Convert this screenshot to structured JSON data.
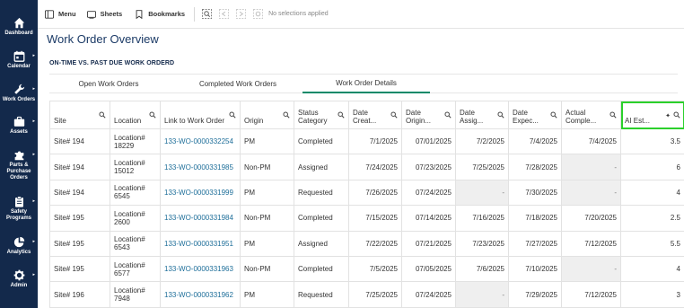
{
  "sidebar": {
    "items": [
      {
        "label": "Dashboard",
        "icon": "home-icon",
        "has_arrow": false
      },
      {
        "label": "Calendar",
        "icon": "calendar-icon",
        "has_arrow": true
      },
      {
        "label": "Work Orders",
        "icon": "wrench-icon",
        "has_arrow": true
      },
      {
        "label": "Assets",
        "icon": "briefcase-icon",
        "has_arrow": true
      },
      {
        "label": "Parts &\nPurchase\nOrders",
        "icon": "puzzle-icon",
        "has_arrow": true
      },
      {
        "label": "Safety\nPrograms",
        "icon": "clipboard-icon",
        "has_arrow": true
      },
      {
        "label": "Analytics",
        "icon": "pie-chart-icon",
        "has_arrow": true
      },
      {
        "label": "Admin",
        "icon": "gear-icon",
        "has_arrow": true
      }
    ]
  },
  "toolbar": {
    "menu_label": "Menu",
    "sheets_label": "Sheets",
    "bookmarks_label": "Bookmarks",
    "selection_status": "No selections applied"
  },
  "page_title": "Work Order Overview",
  "section_title": "ON-TIME VS. PAST DUE WORK ORDERD",
  "tabs": [
    {
      "label": "Open Work Orders",
      "active": false
    },
    {
      "label": "Completed Work Orders",
      "active": false
    },
    {
      "label": "Work Order Details",
      "active": true
    }
  ],
  "table": {
    "columns": [
      "Site",
      "Location",
      "Link to Work Order",
      "Origin",
      "Status Category",
      "Date Creat...",
      "Date Origin...",
      "Date Assig...",
      "Date Expec...",
      "Actual Comple...",
      "AI Est..."
    ],
    "rows": [
      [
        "Site# 194",
        "Location# 18229",
        "133-WO-0000332254",
        "PM",
        "Completed",
        "7/1/2025",
        "07/01/2025",
        "7/2/2025",
        "7/4/2025",
        "7/4/2025",
        "3.5"
      ],
      [
        "Site# 194",
        "Location# 15012",
        "133-WO-0000331985",
        "Non-PM",
        "Assigned",
        "7/24/2025",
        "07/23/2025",
        "7/25/2025",
        "7/28/2025",
        "-",
        "6"
      ],
      [
        "Site# 194",
        "Location# 6545",
        "133-WO-0000331999",
        "PM",
        "Requested",
        "7/26/2025",
        "07/24/2025",
        "-",
        "7/30/2025",
        "-",
        "4"
      ],
      [
        "Site# 195",
        "Location# 2600",
        "133-WO-0000331984",
        "Non-PM",
        "Completed",
        "7/15/2025",
        "07/14/2025",
        "7/16/2025",
        "7/18/2025",
        "7/20/2025",
        "2.5"
      ],
      [
        "Site# 195",
        "Location# 6543",
        "133-WO-0000331951",
        "PM",
        "Assigned",
        "7/22/2025",
        "07/21/2025",
        "7/23/2025",
        "7/27/2025",
        "7/12/2025",
        "5.5"
      ],
      [
        "Site# 195",
        "Location# 6577",
        "133-WO-0000331963",
        "Non-PM",
        "Completed",
        "7/5/2025",
        "07/05/2025",
        "7/6/2025",
        "7/10/2025",
        "-",
        "4"
      ],
      [
        "Site# 196",
        "Location# 7948",
        "133-WO-0000331962",
        "PM",
        "Requested",
        "7/25/2025",
        "07/24/2025",
        "-",
        "7/29/2025",
        "7/12/2025",
        "3"
      ]
    ]
  },
  "colors": {
    "sidebar_bg": "#13294b",
    "title": "#1b3a66",
    "link": "#1f6f9a",
    "active_tab": "#0a8a6a",
    "highlight": "#2bd02b"
  }
}
